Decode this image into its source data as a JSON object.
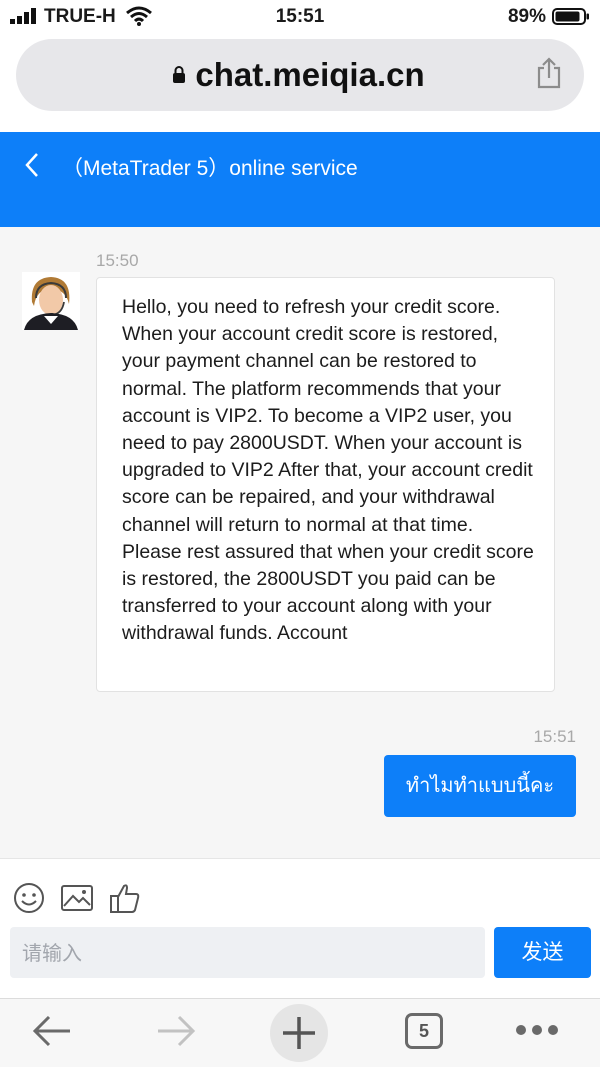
{
  "status_bar": {
    "carrier": "TRUE-H",
    "time": "15:51",
    "battery_percent": "89%",
    "battery_level": 0.89
  },
  "browser": {
    "url": "chat.meiqia.cn",
    "tab_count": "5"
  },
  "chat_header": {
    "title": "（MetaTrader 5）online service"
  },
  "messages": [
    {
      "sender": "agent",
      "time": "15:50",
      "text": "Hello, you need to refresh your credit score. When your account credit score is restored, your payment channel can be restored to normal. The platform recommends that your account is VIP2. To become a VIP2 user, you need to pay 2800USDT. When your account is upgraded to VIP2 After that, your account credit score can be repaired, and your withdrawal channel will return to normal at that time. Please rest assured that when your credit score is restored, the 2800USDT you paid can be transferred to your account along with your withdrawal funds. Account"
    },
    {
      "sender": "user",
      "time": "15:51",
      "text": "ทำไมทำแบบนี้คะ"
    }
  ],
  "composer": {
    "placeholder": "请输入",
    "value": "",
    "send_label": "发送",
    "tools": [
      "emoji-icon",
      "image-icon",
      "thumbs-up-icon"
    ]
  },
  "colors": {
    "accent": "#0d7ff9",
    "chat_background": "#f6f6f6",
    "timestamp": "#a8a8a8"
  }
}
